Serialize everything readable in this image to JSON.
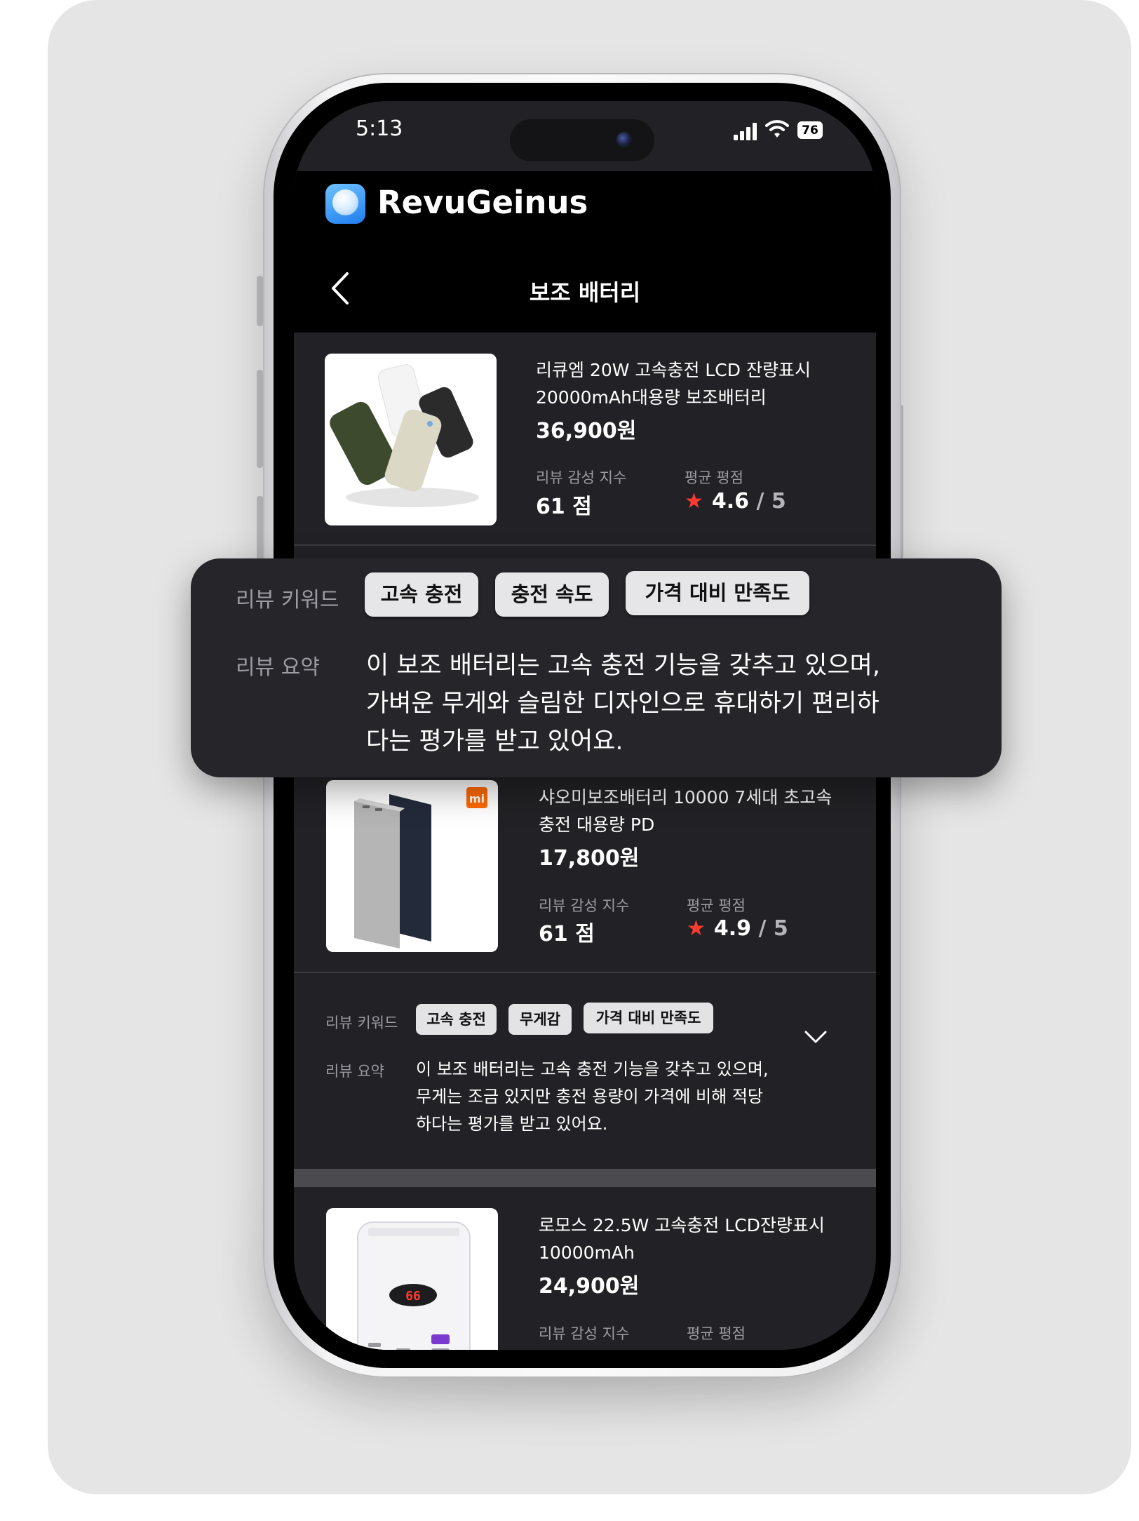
{
  "status_bar": {
    "time": "5:13",
    "battery": "76"
  },
  "app": {
    "title": "RevuGeinus"
  },
  "nav": {
    "title": "보조 배터리"
  },
  "products": [
    {
      "name_line1": "리큐엠 20W 고속충전 LCD 잔량표시",
      "name_line2": "20000mAh대용량 보조배터리",
      "price": "36,900원",
      "sentiment_label": "리뷰 감성 지수",
      "sentiment_value": "61 점",
      "rating_label": "평균 평점",
      "rating_value": "4.6",
      "rating_total": "/ 5"
    },
    {
      "name_line1": "샤오미보조배터리 10000 7세대 초고속",
      "name_line2": "충전 대용량 PD",
      "price": "17,800원",
      "sentiment_label": "리뷰 감성 지수",
      "sentiment_value": "61 점",
      "rating_label": "평균 평점",
      "rating_value": "4.9",
      "rating_total": "/ 5"
    },
    {
      "name_line1": "로모스 22.5W 고속충전 LCD잔량표시",
      "name_line2": "10000mAh",
      "price": "24,900원",
      "sentiment_label": "리뷰 감성 지수",
      "rating_label": "평균 평점"
    }
  ],
  "review_panel": {
    "keywords_label": "리뷰 키워드",
    "summary_label": "리뷰 요약",
    "keywords": [
      "고속 충전",
      "무게감",
      "가격 대비 만족도"
    ],
    "summary_lines": [
      "이 보조 배터리는 고속 충전 기능을 갖추고 있으며,",
      "무게는 조금 있지만 충전 용량이 가격에 비해 적당",
      "하다는 평가를 받고 있어요."
    ]
  },
  "overlay": {
    "keywords_label": "리뷰 키워드",
    "summary_label": "리뷰 요약",
    "keywords": [
      "고속 충전",
      "충전 속도",
      "가격 대비  만족도"
    ],
    "summary_lines": [
      "이 보조 배터리는 고속 충전 기능을 갖추고 있으며,",
      "가벼운 무게와 슬림한 디자인으로 휴대하기 편리하",
      "다는 평가를 받고 있어요."
    ]
  },
  "icons": {
    "back": "chevron-left-icon",
    "expand": "chevron-down-icon",
    "star": "star-icon",
    "logo": "app-logo-icon"
  },
  "colors": {
    "star": "#ff3b30",
    "accent": "#1f7df0",
    "screen_bg": "#222226"
  }
}
